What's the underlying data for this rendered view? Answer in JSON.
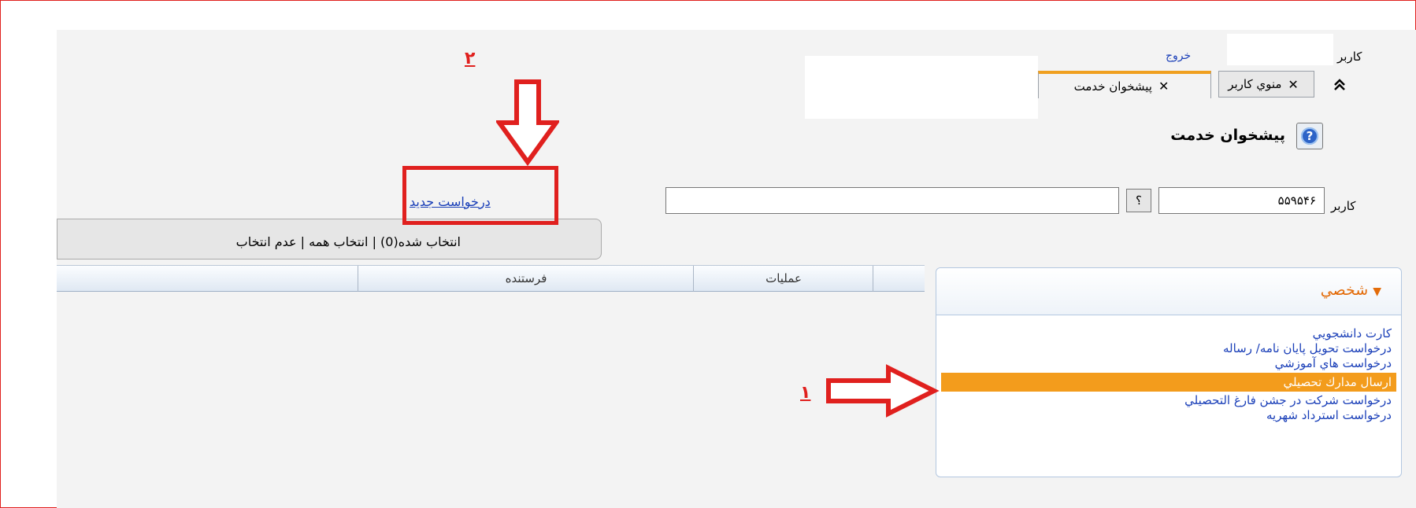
{
  "header": {
    "user_label": "كاربر",
    "logout_label": "خروج",
    "tabs": [
      {
        "label": "منوي كاربر",
        "close": "✕"
      },
      {
        "label": "پيشخوان خدمت",
        "close": "✕"
      }
    ],
    "collapse_icon": "chevrons-up-icon"
  },
  "page": {
    "help_symbol": "?",
    "title": "پيشخوان خدمت"
  },
  "user_row": {
    "label": "كاربر",
    "user_value": "۵۵۹۵۴۶",
    "lookup_label": "؟",
    "name_value": ""
  },
  "actions": {
    "new_request_label": "درخواست جديد"
  },
  "selection": {
    "text": "انتخاب شده(0) | انتخاب همه | عدم انتخاب"
  },
  "grid": {
    "columns": [
      "عمليات",
      "فرستنده"
    ]
  },
  "panel": {
    "title": "شخصي",
    "chevron": "▼",
    "items": [
      "كارت دانشجويي",
      "درخواست تحويل پايان نامه/ رساله",
      "درخواست هاي آموزشي",
      "ارسال مدارك تحصيلي",
      "درخواست شركت در جشن فارغ التحصيلي",
      "درخواست استرداد شهريه"
    ],
    "active_index": 3
  },
  "annotations": {
    "step1": "۱",
    "step2": "۲"
  },
  "colors": {
    "annotation_red": "#e0201e",
    "active_item": "#f39c1c",
    "link_blue": "#1a3fb8",
    "panel_title": "#e36c0a"
  }
}
